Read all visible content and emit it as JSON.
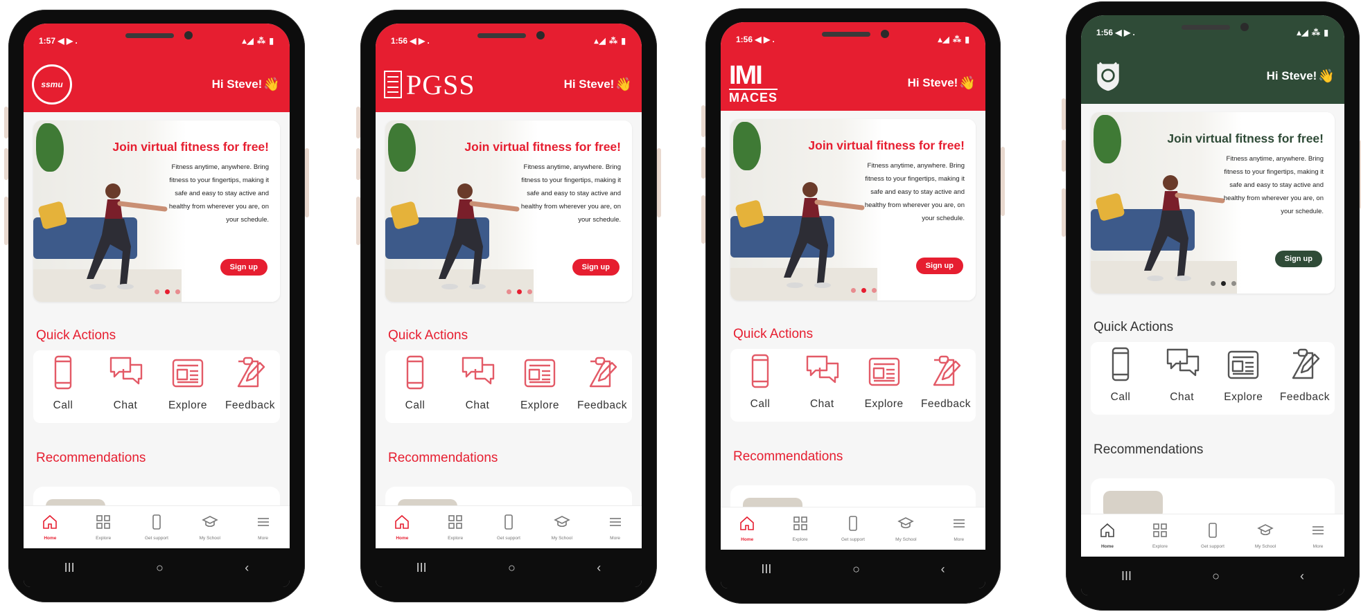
{
  "colors": {
    "red": "#e61e30",
    "green": "#2f4b37"
  },
  "phones": [
    {
      "brand": "ssmu",
      "accent": "#e61e30",
      "icon_color": "#e35a67",
      "status": {
        "time": "1:57",
        "icons": "◀ ▶ .",
        "system": "▴◢ ⁂ ▮"
      },
      "logo_text": "ssmu",
      "greeting": "Hi Steve!",
      "wave": "👋",
      "banner": {
        "title": "Join virtual fitness for free!",
        "desc": "Fitness anytime, anywhere. Bring fitness to your fingertips, making it safe and easy to stay active and healthy from wherever you are, on your schedule.",
        "cta": "Sign up"
      },
      "quick_actions_title": "Quick Actions",
      "actions": [
        "Call",
        "Chat",
        "Explore",
        "Feedback"
      ],
      "recommendations_title": "Recommendations",
      "tabs": [
        "Home",
        "Explore",
        "Get support",
        "My School",
        "More"
      ],
      "nav": [
        "III",
        "○",
        "‹"
      ]
    },
    {
      "brand": "pgss",
      "accent": "#e61e30",
      "icon_color": "#e35a67",
      "status": {
        "time": "1:56",
        "icons": "◀ ▶ .",
        "system": "▴◢ ⁂ ▮"
      },
      "logo_text": "PGSS",
      "greeting": "Hi Steve!",
      "wave": "👋",
      "banner": {
        "title": "Join virtual fitness for free!",
        "desc": "Fitness anytime, anywhere. Bring fitness to your fingertips, making it safe and easy to stay active and healthy from wherever you are, on your schedule.",
        "cta": "Sign up"
      },
      "quick_actions_title": "Quick Actions",
      "actions": [
        "Call",
        "Chat",
        "Explore",
        "Feedback"
      ],
      "recommendations_title": "Recommendations",
      "tabs": [
        "Home",
        "Explore",
        "Get support",
        "My School",
        "More"
      ],
      "nav": [
        "III",
        "○",
        "‹"
      ]
    },
    {
      "brand": "maces",
      "accent": "#e61e30",
      "icon_color": "#e35a67",
      "status": {
        "time": "1:56",
        "icons": "◀ ▶ .",
        "system": "▴◢ ⁂ ▮"
      },
      "logo_text": "MACES",
      "logo_mark": "IMI",
      "greeting": "Hi Steve!",
      "wave": "👋",
      "banner": {
        "title": "Join virtual fitness for free!",
        "desc": "Fitness anytime, anywhere. Bring fitness to your fingertips, making it safe and easy to stay active and healthy from wherever you are, on your schedule.",
        "cta": "Sign up"
      },
      "quick_actions_title": "Quick Actions",
      "actions": [
        "Call",
        "Chat",
        "Explore",
        "Feedback"
      ],
      "recommendations_title": "Recommendations",
      "tabs": [
        "Home",
        "Explore",
        "Get support",
        "My School",
        "More"
      ],
      "nav": [
        "III",
        "○",
        "‹"
      ]
    },
    {
      "brand": "crest",
      "accent": "#2f4b37",
      "icon_color": "#555555",
      "status": {
        "time": "1:56",
        "icons": "◀ ▶ .",
        "system": "▴◢ ⁂ ▮"
      },
      "greeting": "Hi Steve!",
      "wave": "👋",
      "banner": {
        "title": "Join virtual fitness for free!",
        "desc": "Fitness anytime, anywhere. Bring fitness to your fingertips, making it safe and easy to stay active and healthy from wherever you are, on your schedule.",
        "cta": "Sign up"
      },
      "quick_actions_title": "Quick Actions",
      "actions": [
        "Call",
        "Chat",
        "Explore",
        "Feedback"
      ],
      "recommendations_title": "Recommendations",
      "tabs": [
        "Home",
        "Explore",
        "Get support",
        "My School",
        "More"
      ],
      "nav": [
        "III",
        "○",
        "‹"
      ]
    }
  ]
}
